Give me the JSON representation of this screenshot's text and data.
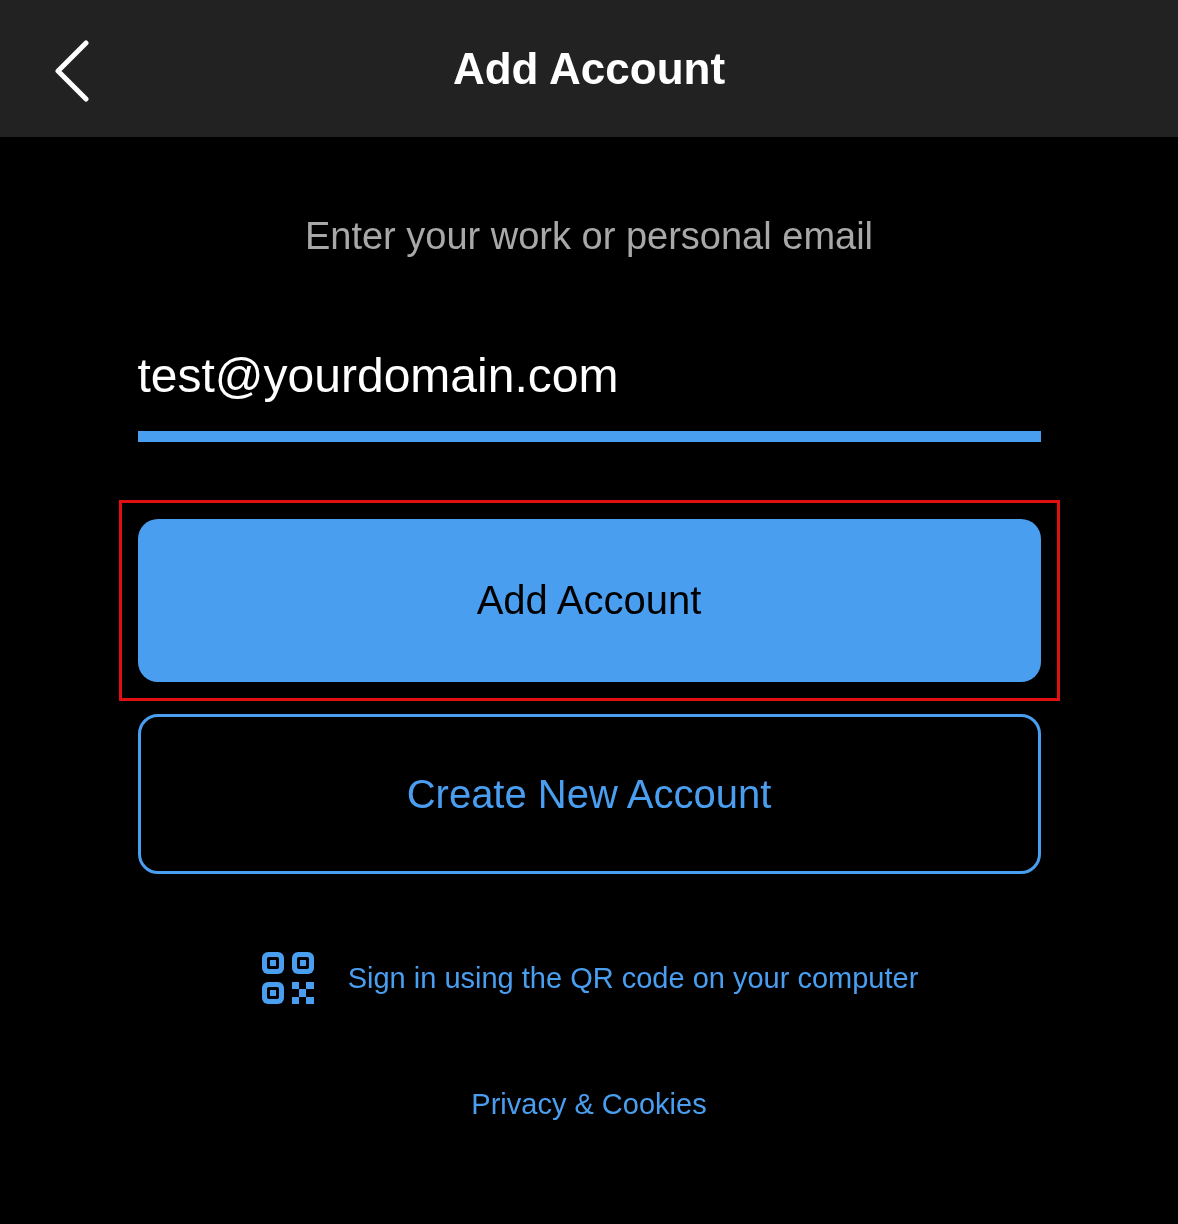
{
  "header": {
    "title": "Add Account"
  },
  "prompt": "Enter your work or personal email",
  "email_field": {
    "value": "test@yourdomain.com",
    "focused": true
  },
  "buttons": [
    {
      "label": "Add Account",
      "kind": "primary",
      "highlighted": true
    },
    {
      "label": "Create New Account",
      "kind": "outline",
      "highlighted": false
    }
  ],
  "qr_link": "Sign in using the QR code on your computer",
  "footer_link": "Privacy & Cookies"
}
